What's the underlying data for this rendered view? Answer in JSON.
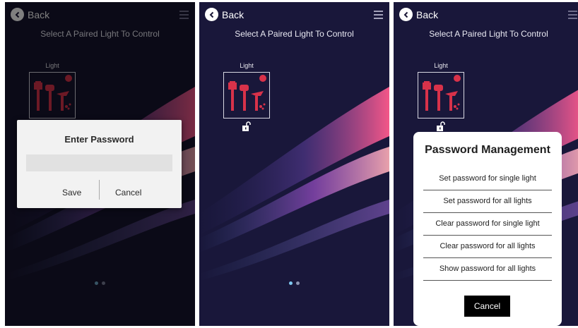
{
  "colors": {
    "bg": "#17142e",
    "light_red": "#d8324a",
    "dot_active": "#7fc8f0",
    "dot_inactive": "#8b93b0"
  },
  "icons": {
    "back": "chevron-left-icon",
    "menu": "hamburger-menu-icon",
    "lock": "unlocked-padlock-icon",
    "light": "garden-lights-icon"
  },
  "screens": [
    {
      "back_label": "Back",
      "subtitle": "Select A Paired Light To Control",
      "light_label": "Light",
      "dialog": {
        "title": "Enter Password",
        "password_value": "",
        "save_label": "Save",
        "cancel_label": "Cancel"
      }
    },
    {
      "back_label": "Back",
      "subtitle": "Select A Paired Light To Control",
      "light_label": "Light"
    },
    {
      "back_label": "Back",
      "subtitle": "Select A Paired Light To Control",
      "light_label": "Light",
      "sheet": {
        "title": "Password Management",
        "options": [
          "Set password for single light",
          "Set password for all lights",
          "Clear password for single light",
          "Clear password for all lights",
          "Show password for all lights"
        ],
        "cancel_label": "Cancel"
      }
    }
  ]
}
